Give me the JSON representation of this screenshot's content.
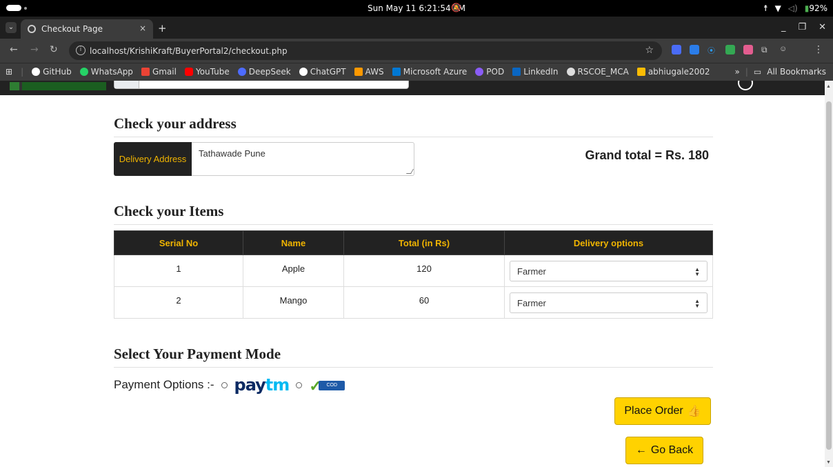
{
  "os": {
    "clock": "Sun May 11   6:21:54 PM",
    "battery": "92%"
  },
  "browser": {
    "tab_title": "Checkout Page",
    "tab_close": "×",
    "new_tab": "+",
    "url": "localhost/KrishiKraft/BuyerPortal2/checkout.php",
    "bookmarks": [
      "GitHub",
      "WhatsApp",
      "Gmail",
      "YouTube",
      "DeepSeek",
      "ChatGPT",
      "AWS",
      "Microsoft Azure",
      "POD",
      "LinkedIn",
      "RSCOE_MCA",
      "abhiugale2002"
    ],
    "bookmark_colors": [
      "#ffffff",
      "#25d366",
      "#ea4335",
      "#ff0000",
      "#4d6bfe",
      "#ffffff",
      "#ff9900",
      "#0078d4",
      "#8a5cf6",
      "#0a66c2",
      "#dddddd",
      "#fbbc04"
    ],
    "overflow": "»",
    "all_bookmarks": "All Bookmarks"
  },
  "checkout": {
    "address_heading": "Check your address",
    "address_label": "Delivery Address",
    "address_value": "Tathawade Pune",
    "grand_total": "Grand total = Rs. 180",
    "items_heading": "Check your Items",
    "table": {
      "headers": [
        "Serial No",
        "Name",
        "Total (in Rs)",
        "Delivery options"
      ],
      "rows": [
        {
          "serial": "1",
          "name": "Apple",
          "total": "120",
          "delivery": "Farmer"
        },
        {
          "serial": "2",
          "name": "Mango",
          "total": "60",
          "delivery": "Farmer"
        }
      ]
    },
    "payment_heading": "Select Your Payment Mode",
    "payment_label": "Payment Options :-",
    "paytm_part1": "pay",
    "paytm_part2": "tm",
    "cod_text": "COD",
    "place_order": "Place Order",
    "go_back": "Go Back"
  },
  "colors": {
    "accent": "#f0b400",
    "button": "#ffd200",
    "header_bg": "#222222"
  }
}
